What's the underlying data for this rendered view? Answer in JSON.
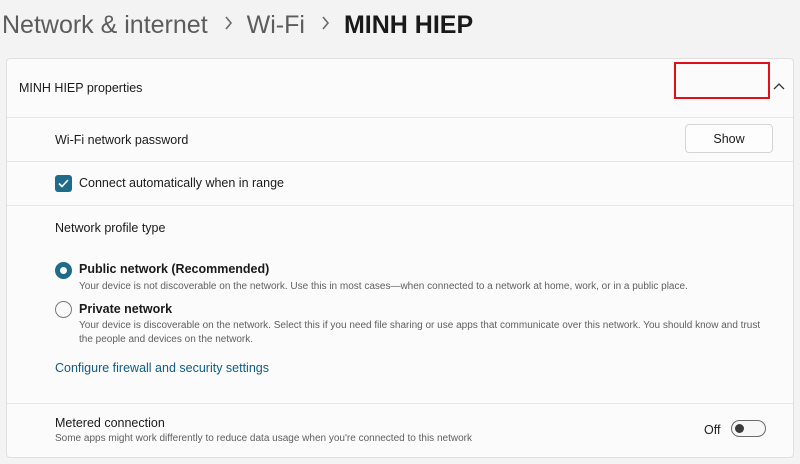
{
  "breadcrumb": {
    "items": [
      "Network & internet",
      "Wi-Fi"
    ],
    "current": "MINH HIEP",
    "separator_icon": "chevron-right-icon"
  },
  "card": {
    "title": "MINH HIEP properties",
    "collapse_icon": "chevron-up-icon"
  },
  "password_row": {
    "label": "Wi-Fi network password",
    "button_label": "Show",
    "highlight_color": "#e0101a"
  },
  "auto_connect": {
    "label": "Connect automatically when in range",
    "checked": true
  },
  "profile": {
    "heading": "Network profile type",
    "options": [
      {
        "title": "Public network (Recommended)",
        "description": "Your device is not discoverable on the network. Use this in most cases—when connected to a network at home, work, or in a public place.",
        "selected": true
      },
      {
        "title": "Private network",
        "description": "Your device is discoverable on the network. Select this if you need file sharing or use apps that communicate over this network. You should know and trust the people and devices on the network.",
        "selected": false
      }
    ],
    "firewall_link": "Configure firewall and security settings"
  },
  "metered": {
    "title": "Metered connection",
    "description": "Some apps might work differently to reduce data usage when you're connected to this network",
    "toggle_state": "Off"
  },
  "colors": {
    "accent": "#1f6c8a",
    "link": "#0e5c84",
    "highlight": "#e0101a"
  }
}
